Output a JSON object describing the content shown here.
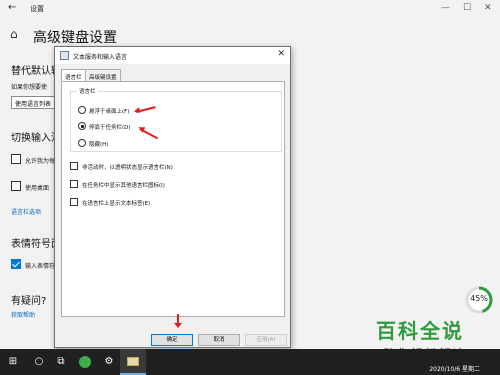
{
  "window": {
    "app_name": "设置",
    "back_glyph": "←",
    "min_glyph": "—",
    "max_glyph": "☐",
    "close_glyph": "✕"
  },
  "page": {
    "home_glyph": "⌂",
    "title": "高级键盘设置",
    "section1_title": "替代默认输",
    "section1_desc": "如果你想要使",
    "combo_value": "使用语言列表",
    "section2_title": "切换输入法",
    "check1_label": "允许我为每",
    "check2_label": "使用桌面",
    "link1": "语言栏选项",
    "section3_title": "表情符号面",
    "check3_label": "输入表情符",
    "section4_title": "有疑问?",
    "link2": "获取帮助"
  },
  "dialog": {
    "title": "文本服务和输入语言",
    "close_glyph": "✕",
    "tabs": [
      "语言栏",
      "高级键设置"
    ],
    "group_title": "语言栏",
    "radios": [
      {
        "label": "悬浮于桌面上(F)",
        "checked": false
      },
      {
        "label": "停靠于任务栏(D)",
        "checked": true
      },
      {
        "label": "隐藏(H)",
        "checked": false
      }
    ],
    "checkboxes": [
      "非活动时，以透明状态显示语言栏(N)",
      "在任务栏中显示其他语言栏图标(I)",
      "在语言栏上显示文本标签(E)"
    ],
    "buttons": {
      "ok": "确定",
      "cancel": "取消",
      "apply": "应用(A)"
    }
  },
  "overlay": {
    "progress_percent": "45%",
    "progress_value": 0.45,
    "watermark_main": "百科全说",
    "watermark_sub": "助你轻松解决",
    "accent_color": "#2f9b3e",
    "arrow_color": "#e02020"
  },
  "taskbar": {
    "start_glyph": "⊞",
    "search_glyph": "○",
    "taskview_glyph": "⧉",
    "settings_glyph": "⚙",
    "date": "2020/10/6 星期二"
  }
}
